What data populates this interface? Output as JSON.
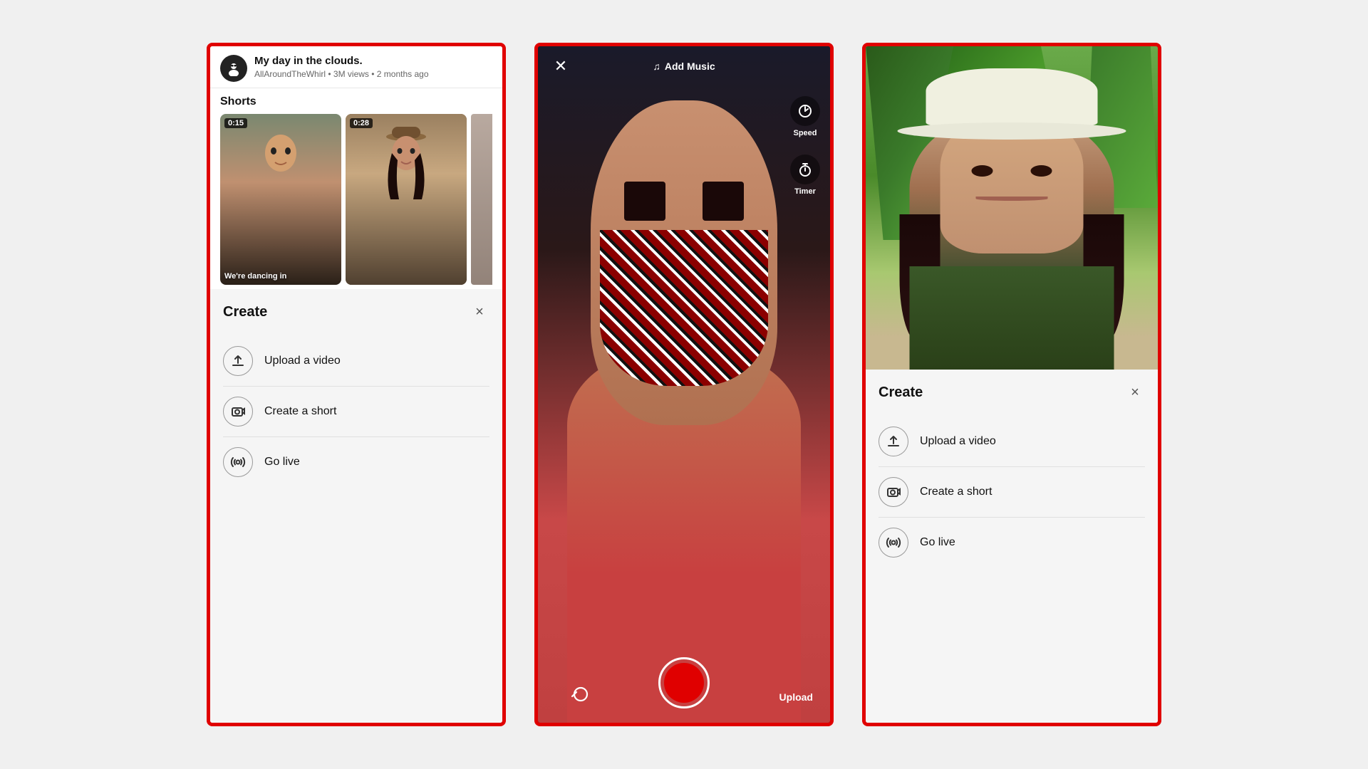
{
  "phone1": {
    "video": {
      "title": "My day in the clouds.",
      "meta": "AllAroundTheWhirl • 3M views • 2 months ago"
    },
    "shorts": {
      "heading": "Shorts",
      "items": [
        {
          "duration": "0:15",
          "caption": "We're dancing in"
        },
        {
          "duration": "0:28",
          "caption": ""
        }
      ]
    },
    "create": {
      "title": "Create",
      "close_label": "×",
      "options": [
        {
          "label": "Upload a video",
          "icon": "upload-icon"
        },
        {
          "label": "Create a short",
          "icon": "camera-icon"
        },
        {
          "label": "Go live",
          "icon": "live-icon"
        }
      ]
    }
  },
  "phone2": {
    "top_bar": {
      "close_label": "×",
      "add_music_label": "Add Music"
    },
    "controls": [
      {
        "label": "Speed",
        "icon": "speed-icon"
      },
      {
        "label": "Timer",
        "icon": "timer-icon"
      }
    ],
    "upload_label": "Upload"
  },
  "phone3": {
    "create": {
      "title": "Create",
      "close_label": "×",
      "options": [
        {
          "label": "Upload a video",
          "icon": "upload-icon"
        },
        {
          "label": "Create a short",
          "icon": "camera-icon"
        },
        {
          "label": "Go live",
          "icon": "live-icon"
        }
      ]
    }
  },
  "colors": {
    "accent_red": "#e00000",
    "border_red": "#e00000"
  }
}
